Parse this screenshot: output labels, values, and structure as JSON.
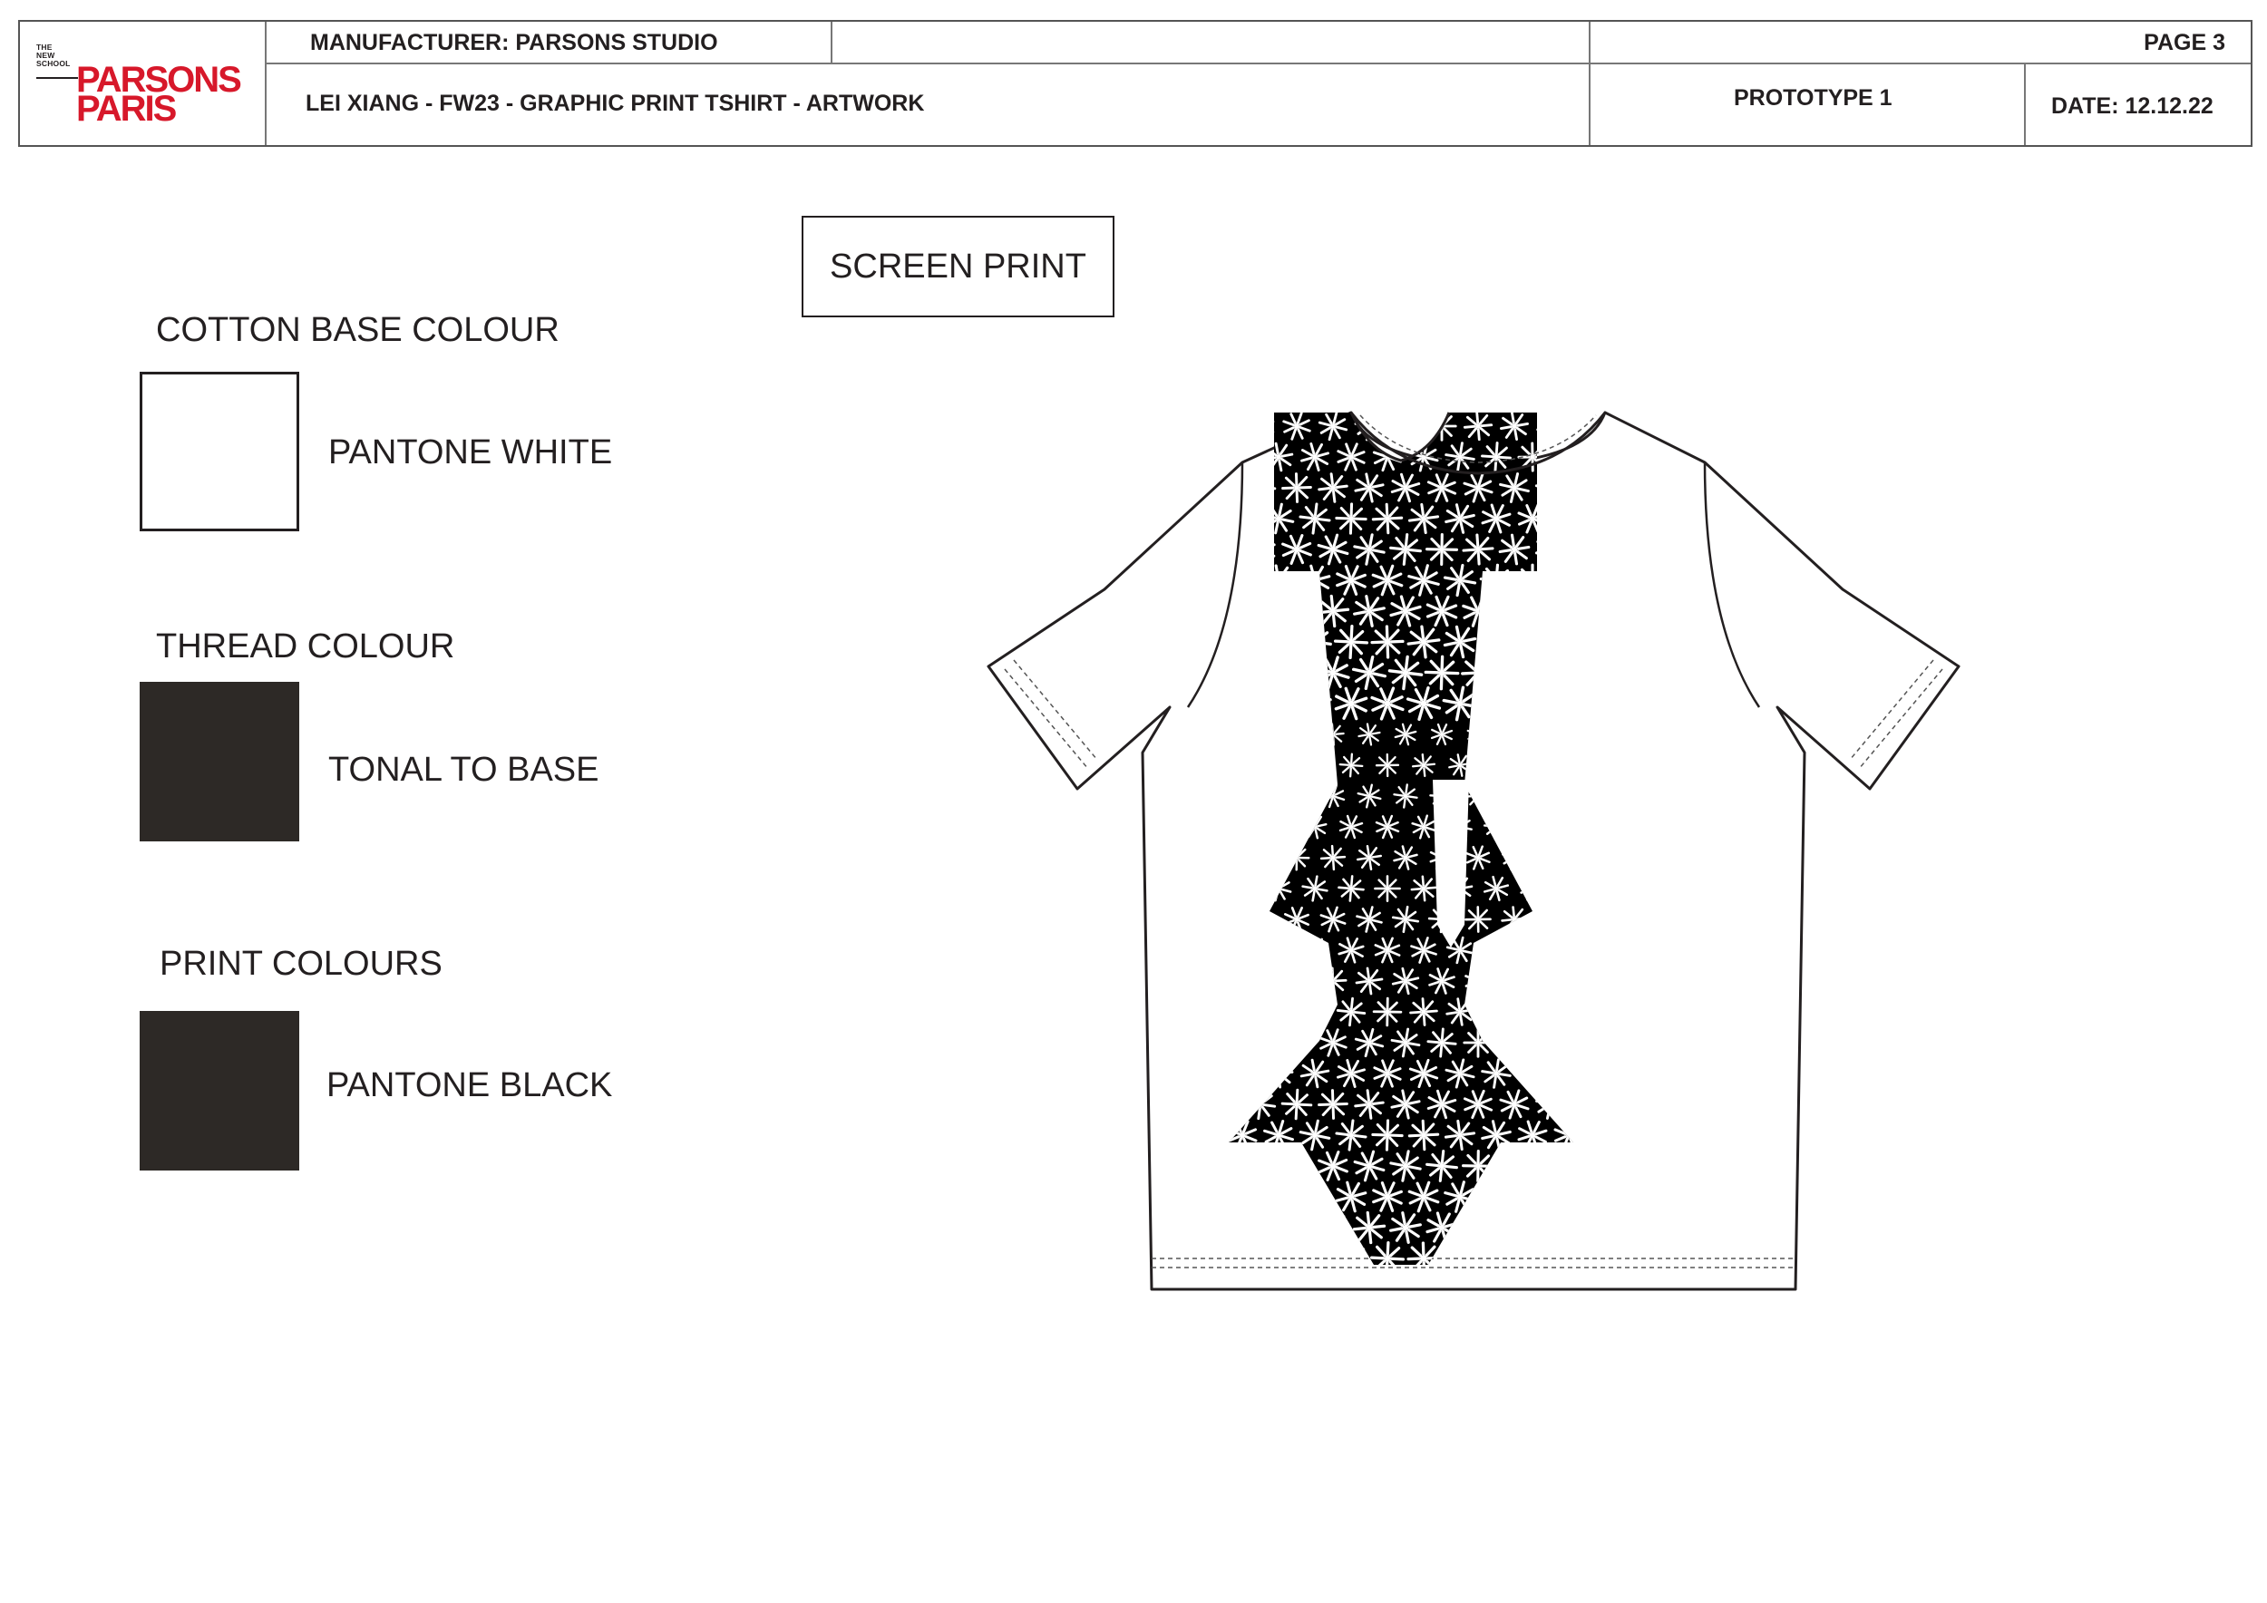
{
  "header": {
    "logo": {
      "small_lines": [
        "THE",
        "NEW",
        "SCHOOL"
      ],
      "main_lines": [
        "PARSONS",
        "PARIS"
      ]
    },
    "manufacturer": "MANUFACTURER: PARSONS STUDIO",
    "page": "PAGE 3",
    "title": "LEI XIANG - FW23 - GRAPHIC PRINT TSHIRT - ARTWORK",
    "prototype": "PROTOTYPE 1",
    "date": "DATE: 12.12.22"
  },
  "method_label": "SCREEN PRINT",
  "colour_specs": [
    {
      "heading": "COTTON BASE COLOUR",
      "value": "PANTONE  WHITE",
      "swatch_color": "#ffffff"
    },
    {
      "heading": "THREAD COLOUR",
      "value": "TONAL TO BASE",
      "swatch_color": "#2d2926"
    },
    {
      "heading": "PRINT COLOURS",
      "value": "PANTONE BLACK",
      "swatch_color": "#2d2926"
    }
  ],
  "colors": {
    "logo_red": "#d7182a",
    "ink": "#231f20",
    "print_black": "#000000"
  }
}
